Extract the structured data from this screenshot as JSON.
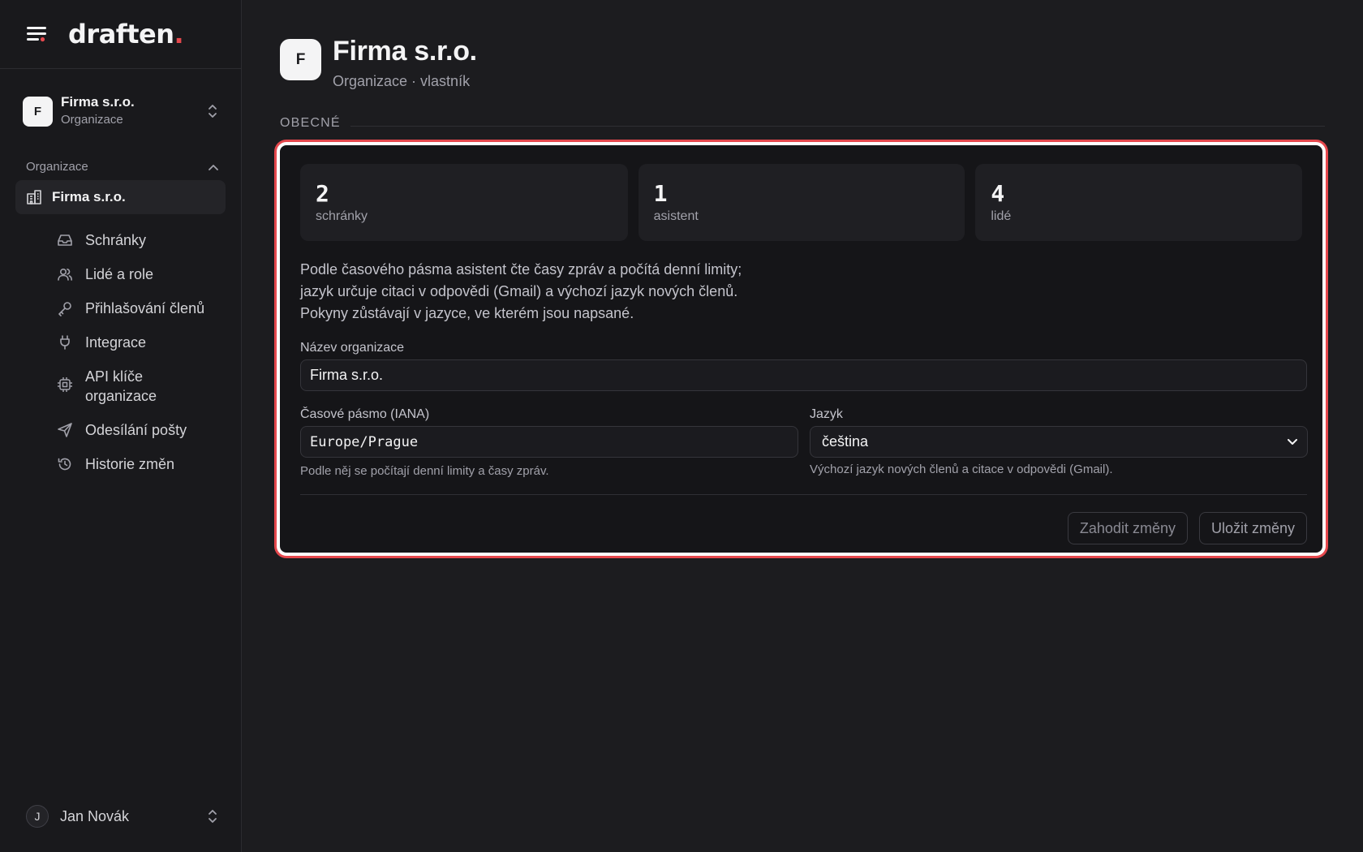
{
  "brand": {
    "logo_text": "draften",
    "logo_dot": "."
  },
  "org_switcher": {
    "avatar_letter": "F",
    "name": "Firma s.r.o.",
    "type": "Organizace"
  },
  "sidebar": {
    "section_title": "Organizace",
    "active_item": {
      "label": "Firma s.r.o.",
      "icon": "building-icon"
    },
    "items": [
      {
        "label": "Schránky",
        "icon": "inbox-icon"
      },
      {
        "label": "Lidé a role",
        "icon": "users-icon"
      },
      {
        "label": "Přihlašování členů",
        "icon": "key-icon"
      },
      {
        "label": "Integrace",
        "icon": "plug-icon"
      },
      {
        "label": "API klíče organizace",
        "icon": "chip-icon"
      },
      {
        "label": "Odesílání pošty",
        "icon": "send-icon"
      },
      {
        "label": "Historie změn",
        "icon": "history-icon"
      }
    ]
  },
  "user": {
    "avatar_letter": "J",
    "name": "Jan Novák"
  },
  "header": {
    "avatar_letter": "F",
    "title": "Firma s.r.o.",
    "subtitle": "Organizace · vlastník"
  },
  "section": {
    "label": "OBECNÉ"
  },
  "stats": [
    {
      "value": "2",
      "label": "schránky"
    },
    {
      "value": "1",
      "label": "asistent"
    },
    {
      "value": "4",
      "label": "lidé"
    }
  ],
  "description": [
    "Podle časového pásma asistent čte časy zpráv a počítá denní limity;",
    "jazyk určuje citaci v odpovědi (Gmail) a výchozí jazyk nových členů.",
    "Pokyny zůstávají v jazyce, ve kterém jsou napsané."
  ],
  "form": {
    "org_name_label": "Název organizace",
    "org_name_value": "Firma s.r.o.",
    "timezone_label": "Časové pásmo (IANA)",
    "timezone_value": "Europe/Prague",
    "timezone_hint": "Podle něj se počítají denní limity a časy zpráv.",
    "language_label": "Jazyk",
    "language_value": "čeština",
    "language_hint": "Výchozí jazyk nových členů a citace v odpovědi (Gmail)."
  },
  "actions": {
    "discard_label": "Zahodit změny",
    "save_label": "Uložit změny"
  },
  "colors": {
    "accent": "#e5484d",
    "background": "#1c1c1f",
    "sidebar": "#19191c",
    "card": "#151518"
  }
}
